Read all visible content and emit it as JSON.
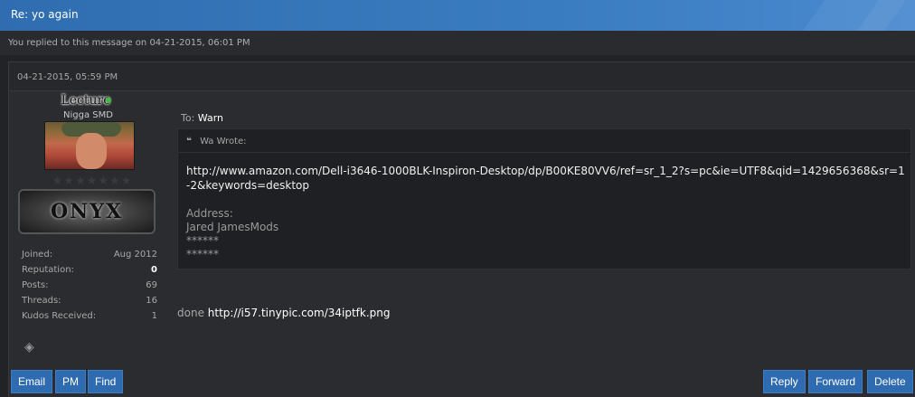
{
  "window": {
    "title": "Re: yo again"
  },
  "info": {
    "replied": "You replied to this message on 04-21-2015, 06:01 PM"
  },
  "post": {
    "date": "04-21-2015, 05:59 PM",
    "user": {
      "name": "Lecture",
      "title": "Nigga SMD",
      "stars": "★★★★★★★",
      "rank": "ONYX",
      "stats": [
        {
          "label": "Joined:",
          "value": "Aug 2012"
        },
        {
          "label": "Reputation:",
          "value": "0"
        },
        {
          "label": "Posts:",
          "value": "69"
        },
        {
          "label": "Threads:",
          "value": "16"
        },
        {
          "label": "Kudos Received:",
          "value": "1"
        }
      ],
      "online_color": "#3cc03c"
    },
    "to_label": "To:",
    "to_name": "Warn",
    "quote": {
      "author": "Wa Wrote:",
      "url": "http://www.amazon.com/Dell-i3646-1000BLK-Inspiron-Desktop/dp/B00KE80VV6/ref=sr_1_2?s=pc&ie=UTF8&qid=1429656368&sr=1-2&keywords=desktop",
      "lines": [
        "Address:",
        "Jared JamesMods",
        "******",
        "******"
      ]
    },
    "done_text": "done",
    "done_link": "http://i57.tinypic.com/34iptfk.png"
  },
  "buttons": {
    "email": "Email",
    "pm": "PM",
    "find": "Find",
    "reply": "Reply",
    "forward": "Forward",
    "delete": "Delete"
  },
  "colors": {
    "accent": "#2f6bb0"
  }
}
